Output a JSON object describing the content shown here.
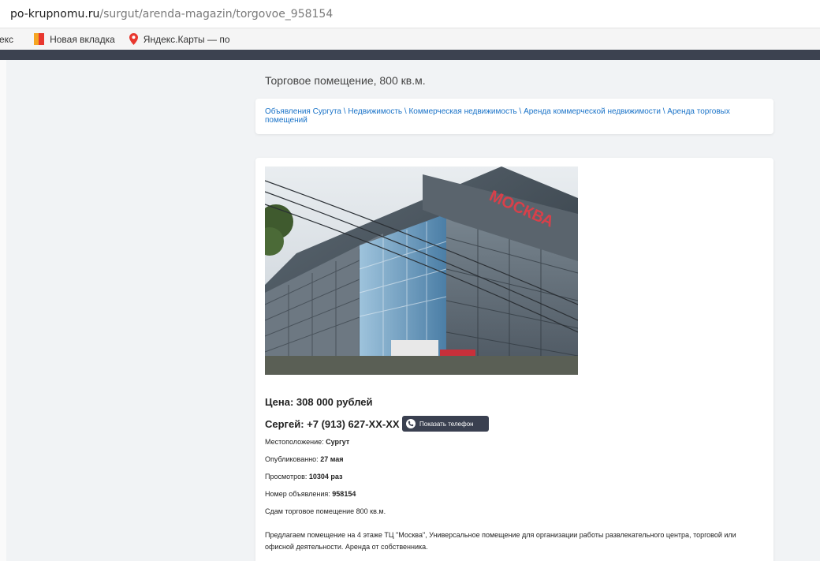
{
  "browser": {
    "url_domain": "po-krupnomu.ru",
    "url_path": "/surgut/arenda-magazin/torgovoe_958154",
    "bookmarks": [
      {
        "label": "екс"
      },
      {
        "label": "Новая вкладка",
        "icon": "bookmark-flag-icon",
        "colors": [
          "#f5a623",
          "#e8382f"
        ]
      },
      {
        "label": "Яндекс.Карты — по",
        "icon": "map-pin-icon",
        "color": "#e8382f"
      }
    ]
  },
  "page": {
    "title": "Торговое помещение, 800 кв.м.",
    "breadcrumbs": [
      "Объявления Сургута",
      "Недвижимость",
      "Коммерческая недвижимость",
      "Аренда коммерческой недвижимости",
      "Аренда торговых помещений"
    ],
    "breadcrumb_separator": " \\ "
  },
  "listing": {
    "photo": {
      "icon": "building-photo",
      "sign_text": "МОСКВА"
    },
    "price": "Цена: 308 000 рублей",
    "seller": "Сергей: +7 (913) 627-XX-XX",
    "show_phone_button": "Показать телефон",
    "location_label": "Местоположение:",
    "location_value": "Сургут",
    "published_label": "Опубликованно:",
    "published_value": "27 мая",
    "views_label": "Просмотров:",
    "views_value": "10304 раз",
    "ad_number_label": "Номер объявления:",
    "ad_number_value": "958154",
    "summary": "Сдам торговое помещение 800 кв.м.",
    "description": "Предлагаем помещение на 4 этаже ТЦ \"Москва\", Универсальное помещение для организации работы развлекательного центра, торговой или офисной деятельности. Аренда от собственника."
  },
  "colors": {
    "link": "#1a73c8",
    "dark_strip": "#3c4250",
    "button_bg": "#3a4050"
  }
}
